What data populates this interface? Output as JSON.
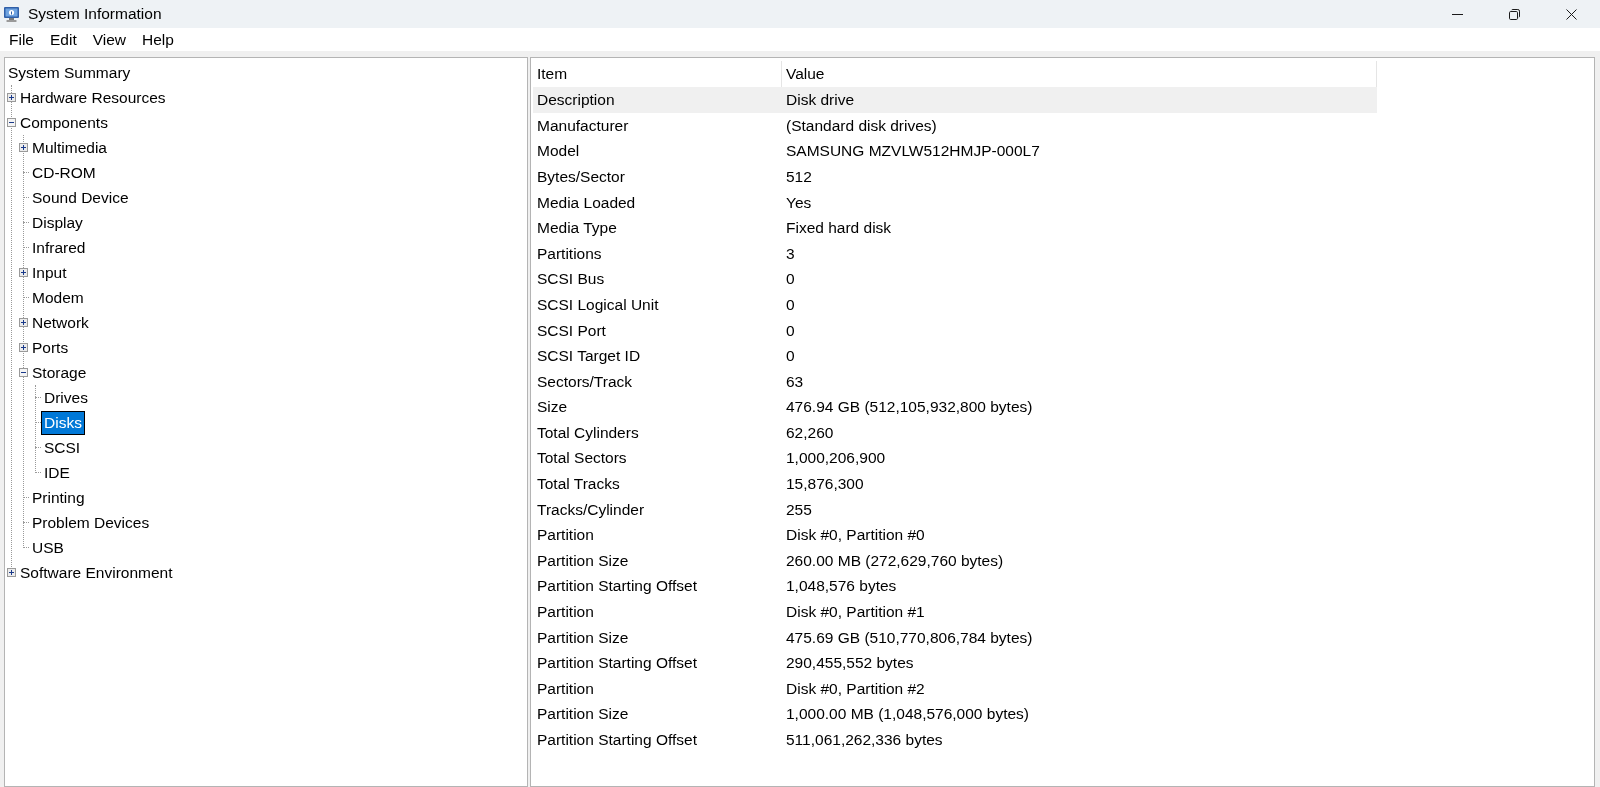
{
  "window": {
    "title": "System Information"
  },
  "menu": [
    "File",
    "Edit",
    "View",
    "Help"
  ],
  "tree": [
    {
      "label": "System Summary",
      "selected": false,
      "children": [
        {
          "label": "Hardware Resources",
          "expanded": false,
          "selected": false
        },
        {
          "label": "Components",
          "expanded": true,
          "selected": false,
          "children": [
            {
              "label": "Multimedia",
              "expanded": false,
              "selected": false
            },
            {
              "label": "CD-ROM",
              "selected": false
            },
            {
              "label": "Sound Device",
              "selected": false
            },
            {
              "label": "Display",
              "selected": false
            },
            {
              "label": "Infrared",
              "selected": false
            },
            {
              "label": "Input",
              "expanded": false,
              "selected": false
            },
            {
              "label": "Modem",
              "selected": false
            },
            {
              "label": "Network",
              "expanded": false,
              "selected": false
            },
            {
              "label": "Ports",
              "expanded": false,
              "selected": false
            },
            {
              "label": "Storage",
              "expanded": true,
              "selected": false,
              "children": [
                {
                  "label": "Drives",
                  "selected": false
                },
                {
                  "label": "Disks",
                  "selected": true
                },
                {
                  "label": "SCSI",
                  "selected": false
                },
                {
                  "label": "IDE",
                  "selected": false
                }
              ]
            },
            {
              "label": "Printing",
              "selected": false
            },
            {
              "label": "Problem Devices",
              "selected": false
            },
            {
              "label": "USB",
              "selected": false
            }
          ]
        },
        {
          "label": "Software Environment",
          "expanded": false,
          "selected": false
        }
      ]
    }
  ],
  "table": {
    "columns": [
      "Item",
      "Value"
    ],
    "rows": [
      {
        "item": "Description",
        "value": "Disk drive",
        "selected": true
      },
      {
        "item": "Manufacturer",
        "value": "(Standard disk drives)",
        "selected": false
      },
      {
        "item": "Model",
        "value": "SAMSUNG MZVLW512HMJP-000L7",
        "selected": false
      },
      {
        "item": "Bytes/Sector",
        "value": "512",
        "selected": false
      },
      {
        "item": "Media Loaded",
        "value": "Yes",
        "selected": false
      },
      {
        "item": "Media Type",
        "value": "Fixed hard disk",
        "selected": false
      },
      {
        "item": "Partitions",
        "value": "3",
        "selected": false
      },
      {
        "item": "SCSI Bus",
        "value": "0",
        "selected": false
      },
      {
        "item": "SCSI Logical Unit",
        "value": "0",
        "selected": false
      },
      {
        "item": "SCSI Port",
        "value": "0",
        "selected": false
      },
      {
        "item": "SCSI Target ID",
        "value": "0",
        "selected": false
      },
      {
        "item": "Sectors/Track",
        "value": "63",
        "selected": false
      },
      {
        "item": "Size",
        "value": "476.94 GB (512,105,932,800 bytes)",
        "selected": false
      },
      {
        "item": "Total Cylinders",
        "value": "62,260",
        "selected": false
      },
      {
        "item": "Total Sectors",
        "value": "1,000,206,900",
        "selected": false
      },
      {
        "item": "Total Tracks",
        "value": "15,876,300",
        "selected": false
      },
      {
        "item": "Tracks/Cylinder",
        "value": "255",
        "selected": false
      },
      {
        "item": "Partition",
        "value": "Disk #0, Partition #0",
        "selected": false
      },
      {
        "item": "Partition Size",
        "value": "260.00 MB (272,629,760 bytes)",
        "selected": false
      },
      {
        "item": "Partition Starting Offset",
        "value": "1,048,576 bytes",
        "selected": false
      },
      {
        "item": "Partition",
        "value": "Disk #0, Partition #1",
        "selected": false
      },
      {
        "item": "Partition Size",
        "value": "475.69 GB (510,770,806,784 bytes)",
        "selected": false
      },
      {
        "item": "Partition Starting Offset",
        "value": "290,455,552 bytes",
        "selected": false
      },
      {
        "item": "Partition",
        "value": "Disk #0, Partition #2",
        "selected": false
      },
      {
        "item": "Partition Size",
        "value": "1,000.00 MB (1,048,576,000 bytes)",
        "selected": false
      },
      {
        "item": "Partition Starting Offset",
        "value": "511,061,262,336 bytes",
        "selected": false
      }
    ]
  }
}
